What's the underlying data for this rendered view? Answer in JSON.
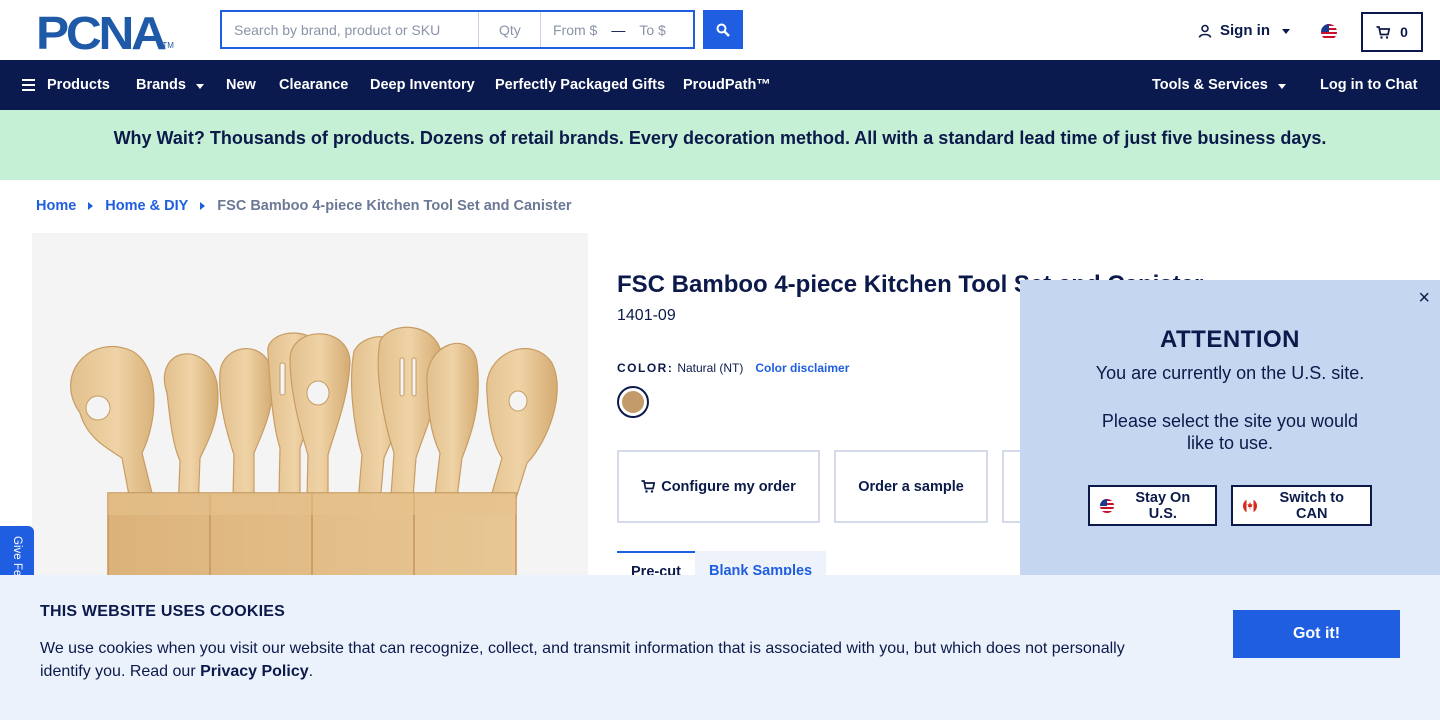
{
  "header": {
    "logo_text": "PCNA",
    "logo_tm": "TM",
    "search": {
      "placeholder": "Search by brand, product or SKU",
      "qty_placeholder": "Qty",
      "from_placeholder": "From $",
      "to_placeholder": "To $"
    },
    "signin_label": "Sign in",
    "cart_count": "0"
  },
  "nav": {
    "products": "Products",
    "brands": "Brands",
    "new": "New",
    "clearance": "Clearance",
    "deep_inventory": "Deep Inventory",
    "gifts": "Perfectly Packaged Gifts",
    "proudpath": "ProudPath™",
    "tools": "Tools & Services",
    "chat": "Log in to Chat"
  },
  "banner": {
    "text": "Why Wait? Thousands of products. Dozens of retail brands. Every decoration method. All with a standard lead time of just five business days."
  },
  "breadcrumb": {
    "home": "Home",
    "category": "Home & DIY",
    "current": "FSC Bamboo 4-piece Kitchen Tool Set and Canister"
  },
  "product": {
    "title": "FSC Bamboo 4-piece Kitchen Tool Set and Canister",
    "sku": "1401-09",
    "color_label": "COLOR:",
    "color_value": "Natural (NT)",
    "color_disclaimer": "Color disclaimer",
    "swatch_color": "#c39a6a",
    "configure_label": "Configure my order",
    "sample_label": "Order a sample",
    "tabs": [
      "Pre-cut",
      "Blank Samples"
    ]
  },
  "feedback": {
    "label": "Give Feedback"
  },
  "attention": {
    "title": "ATTENTION",
    "line1": "You are currently on the U.S. site.",
    "line2": "Please select the site you would like to use.",
    "stay_label": "Stay On U.S.",
    "switch_label": "Switch to CAN",
    "close": "×"
  },
  "cookie": {
    "title": "THIS WEBSITE USES COOKIES",
    "message": "We use cookies when you visit our website that can recognize, collect, and transmit information that is associated with you, but which does not personally identify you. Read our ",
    "policy_link": "Privacy Policy",
    "period": ".",
    "button": "Got it!"
  },
  "colors": {
    "brand_blue": "#1f5ee0",
    "navy": "#0a1a4f",
    "banner_green": "#c6f0d6",
    "popup_blue": "#c5d6f1",
    "cookie_bg": "#ecf2fc"
  }
}
